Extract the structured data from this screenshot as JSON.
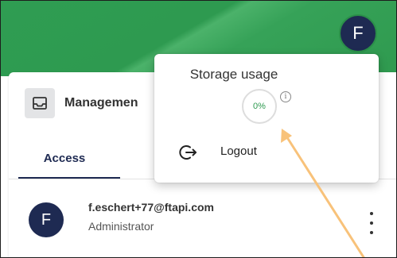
{
  "header": {
    "profile_initial": "F"
  },
  "app": {
    "title": "Managemen",
    "icon": "inbox-tray-icon"
  },
  "tabs": [
    {
      "label": "Access",
      "active": true
    }
  ],
  "user": {
    "initial": "F",
    "email": "f.eschert+77@ftapi.com",
    "role": "Administrator"
  },
  "menu": {
    "storage_title": "Storage usage",
    "storage_percent": "0%",
    "storage_fraction": 0,
    "info_glyph": "i",
    "logout_label": "Logout"
  },
  "colors": {
    "header_green": "#2f9d52",
    "avatar_navy": "#1e2a52",
    "arrow_orange": "#f8c27a",
    "percent_green": "#2e9a50"
  }
}
